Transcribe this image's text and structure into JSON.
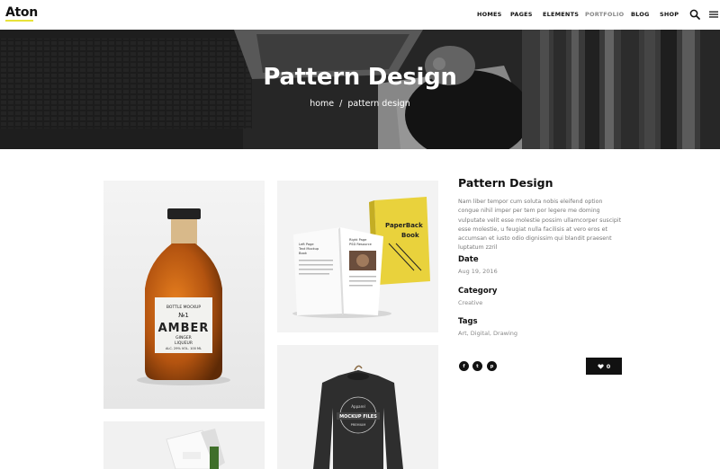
{
  "logo": {
    "text": "Aton",
    "accent": "#e8e23a"
  },
  "nav": {
    "items": [
      "HOMES",
      "PAGES",
      "ELEMENTS",
      "PORTFOLIO",
      "BLOG",
      "SHOP"
    ],
    "active": "PORTFOLIO",
    "icons": [
      "search-icon",
      "menu-icon"
    ]
  },
  "hero": {
    "title": "Pattern Design",
    "breadcrumb": {
      "home": "home",
      "separator": "/",
      "current": "pattern design"
    }
  },
  "gallery": {
    "bottle": {
      "line1": "BOTTLE MOCKUP",
      "line2": "№1",
      "brand": "AMBER",
      "line3": "GINGER",
      "line4": "LIQUEUR",
      "line5": "ALC. 29% VOL. 100 ML"
    },
    "book": {
      "title1": "PaperBack",
      "title2": "Book",
      "left1": "Left Page",
      "left2": "Text Mockup",
      "left3": "Book",
      "right1": "Right Page",
      "right2": "PSD Resource"
    },
    "sweater": {
      "top": "Apparel",
      "main": "MOCKUP FILES",
      "sub": "PREMIUM"
    }
  },
  "project": {
    "title": "Pattern Design",
    "description": "Nam liber tempor cum soluta nobis eleifend option congue nihil imper per tem por legere me doming vulputate velit esse molestie possim ullamcorper suscipit esse molestie, u feugiat nulla facilisis at vero eros et accumsan et iusto odio dignissim qui blandit praesent luptatum zzril",
    "date_label": "Date",
    "date_value": "Aug 19, 2016",
    "category_label": "Category",
    "category_value": "Creative",
    "tags_label": "Tags",
    "tags_value": "Art, Digital, Drawing",
    "social": [
      {
        "name": "facebook-icon",
        "glyph": "f"
      },
      {
        "name": "twitter-icon",
        "glyph": "t"
      },
      {
        "name": "pinterest-icon",
        "glyph": "p"
      }
    ],
    "likes": "0"
  },
  "colors": {
    "dark": "#111111",
    "muted": "#777777",
    "accent": "#e8e23a"
  }
}
